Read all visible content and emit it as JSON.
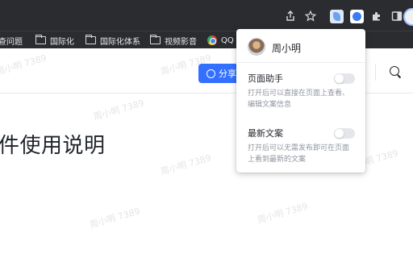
{
  "bookmarks": [
    {
      "label": "查问题",
      "icon": "folder-icon"
    },
    {
      "label": "国际化",
      "icon": "folder-icon"
    },
    {
      "label": "国际化体系",
      "icon": "folder-icon"
    },
    {
      "label": "视频影音",
      "icon": "folder-icon"
    },
    {
      "label": "QQ",
      "icon": "qq-browser-icon"
    }
  ],
  "toolbar": {
    "icons": [
      "share-page-icon",
      "bookmark-star-icon",
      "extension-doc-icon",
      "extension-active-icon",
      "extensions-puzzle-icon",
      "side-panel-icon",
      "profile-avatar-icon"
    ]
  },
  "page": {
    "share_button": "分享",
    "title": "件使用说明",
    "watermark": "周小明 7389"
  },
  "popup": {
    "user_name": "周小明",
    "options": [
      {
        "title": "页面助手",
        "desc_line1": "打开后可以直接在页面上查看、",
        "desc_line2": "编辑文案信息",
        "enabled": false
      },
      {
        "title": "最新文案",
        "desc_line1": "打开后可以无需发布即可在页面",
        "desc_line2": "上看到最新的文案",
        "enabled": false
      }
    ]
  },
  "colors": {
    "chrome_dark": "#2b2c30",
    "accent_blue": "#3370ff",
    "toggle_off": "#e4e6ea",
    "text_primary": "#1f2329",
    "text_secondary": "#8f959e"
  }
}
